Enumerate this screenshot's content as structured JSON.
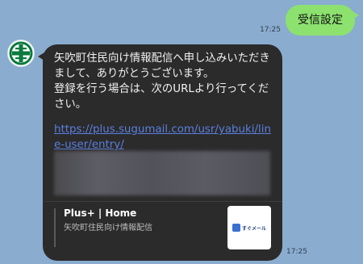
{
  "sent": {
    "time": "17:25",
    "text": "受信設定"
  },
  "received": {
    "time": "17:25",
    "text": "矢吹町住民向け情報配信へ申し込みいただきまして、ありがとうございます。\n登録を行う場合は、次のURLより行ってください。",
    "link": "https://plus.sugumail.com/usr/yabuki/line-user/entry/",
    "preview": {
      "title": "Plus+ | Home",
      "subtitle": "矢吹町住民向け情報配信",
      "thumb_text": "すぐメール"
    }
  },
  "colors": {
    "background": "#8aaccf",
    "sent_bubble": "#8ce16f",
    "received_bubble": "#2b2b2b",
    "link": "#5b7fe0"
  },
  "icons": {
    "avatar": "town-emblem-icon"
  }
}
